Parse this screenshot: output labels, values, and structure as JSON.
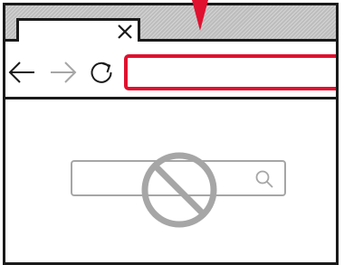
{
  "tab": {
    "title": "",
    "close_icon": "close-icon"
  },
  "toolbar": {
    "back_icon": "arrow-left-icon",
    "forward_icon": "arrow-right-icon",
    "reload_icon": "reload-icon"
  },
  "address_bar": {
    "value": "",
    "placeholder": "",
    "highlight_color": "#e0102f"
  },
  "content": {
    "search": {
      "value": "",
      "placeholder": "",
      "icon": "search-icon"
    },
    "overlay_icon": "blocked-icon"
  },
  "colors": {
    "frame": "#1a1a1a",
    "tabbar": "#bdbdbd",
    "highlight": "#e0102f",
    "disabled_grey": "#a6a6a6"
  }
}
